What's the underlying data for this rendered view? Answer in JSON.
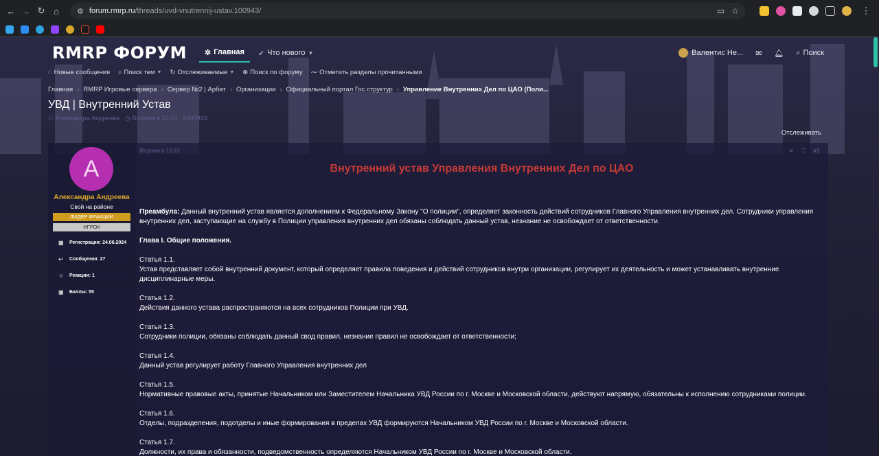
{
  "browser": {
    "url_host": "forum.rmrp.ru",
    "url_path": "/threads/uvd-vnutrennij-ustav.100943/"
  },
  "site": {
    "logo": "RMRP ФОРУМ",
    "nav": [
      {
        "label": "Главная"
      },
      {
        "label": "Что нового"
      }
    ],
    "user_name": "Валентис Не...",
    "search_label": "Поиск"
  },
  "subnav": [
    {
      "label": "Новые сообщения"
    },
    {
      "label": "Поиск тем"
    },
    {
      "label": "Отслеживаемые"
    },
    {
      "label": "Поиск по форуму"
    },
    {
      "label": "Отметить разделы прочитанными"
    }
  ],
  "breadcrumb": [
    "Главная",
    "RMRP Игровые сервера",
    "Сервер №2 | Арбат",
    "Организации",
    "Официальный портал Гос.структур",
    "Управление Внутренних Дел по ЦАО (Поли..."
  ],
  "thread": {
    "title": "УВД | Внутренний Устав",
    "author": "Александра Андреева",
    "date": "Вторник в 15:10",
    "id": "100943",
    "watch_label": "Отслеживать"
  },
  "post": {
    "author": {
      "avatar_letter": "A",
      "name": "Александра Андреева",
      "title": "Свой на районе",
      "banner_leader": "ЛИДЕР ФРАКЦИИ",
      "banner_player": "ИГРОК",
      "stats": {
        "registration": "Регистрация: 24.06.2024",
        "messages": "Сообщения: 27",
        "reactions": "Реакции: 1",
        "points": "Баллы: 55"
      }
    },
    "date": "Вторник в 15:10",
    "number": "#1",
    "heading": "Внутренний устав Управления Внутренних Дел по ЦАО",
    "preamble_label": "Преамбула:",
    "preamble_text": " Данный внутренний устав является дополнением к Федеральному Закону \"О полиции\", определяет законность действий сотрудников Главного Управления внутренних дел. Сотрудники управления внутренних дел, заступающие на службу в Полиции управления внутренних дел обязаны соблюдать данный устав, незнание не освобождает от ответственности.",
    "chapter": "Глава I. Общие положения.",
    "articles": [
      {
        "title": "Статья 1.1.",
        "text": "Устав представляет собой внутренний документ, который определяет правила поведения и действий сотрудников внутри организации, регулирует их деятельность и может устанавливать внутренние дисциплинарные меры."
      },
      {
        "title": "Статья 1.2.",
        "text": "Действия данного устава распространяются на всех сотрудников Полиции при УВД."
      },
      {
        "title": "Статья 1.3.",
        "text": "Сотрудники полиции, обязаны соблюдать данный свод правил, незнание правил не освобождает от ответственности;"
      },
      {
        "title": "Статья 1.4.",
        "text": "Данный устав регулирует работу Главного Управления внутренних дел"
      },
      {
        "title": "Статья 1.5.",
        "text": "Нормативные правовые акты, принятые Начальником или Заместителем Начальника УВД России по г. Москве и Московской области, действуют напрямую, обязательны к исполнению сотрудниками полиции."
      },
      {
        "title": "Статья 1.6.",
        "text": "Отделы, подразделения, подотделы и иные формирования в пределах УВД формируются Начальником УВД России по г. Москве и Московской области."
      },
      {
        "title": "Статья 1.7.",
        "text": "Должности, их права и обязанности, подведомственность определяются Начальником УВД России по г. Москве и Московской области."
      }
    ]
  },
  "colors": {
    "accent": "#2ec4a6",
    "heading_red": "#c63a36",
    "username_gold": "#d9a72c",
    "avatar_magenta": "#b52fb0"
  }
}
